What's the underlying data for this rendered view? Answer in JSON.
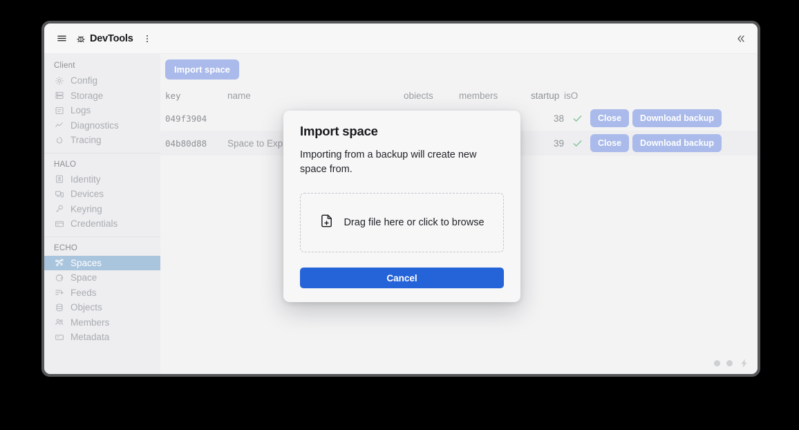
{
  "titlebar": {
    "menu_icon": "hamburger-icon",
    "app_icon": "bug-icon",
    "title": "DevTools",
    "overflow_icon": "more-vertical-icon",
    "collapse_icon": "chevrons-left-icon"
  },
  "sidebar": {
    "sections": [
      {
        "label": "Client",
        "items": [
          {
            "label": "Config",
            "icon": "gear-icon",
            "active": false
          },
          {
            "label": "Storage",
            "icon": "database-icon",
            "active": false
          },
          {
            "label": "Logs",
            "icon": "list-icon",
            "active": false
          },
          {
            "label": "Diagnostics",
            "icon": "chart-line-icon",
            "active": false
          },
          {
            "label": "Tracing",
            "icon": "flame-icon",
            "active": false
          }
        ]
      },
      {
        "label": "HALO",
        "items": [
          {
            "label": "Identity",
            "icon": "id-card-icon",
            "active": false
          },
          {
            "label": "Devices",
            "icon": "devices-icon",
            "active": false
          },
          {
            "label": "Keyring",
            "icon": "key-icon",
            "active": false
          },
          {
            "label": "Credentials",
            "icon": "credit-card-icon",
            "active": false
          }
        ]
      },
      {
        "label": "ECHO",
        "items": [
          {
            "label": "Spaces",
            "icon": "graph-icon",
            "active": true
          },
          {
            "label": "Space",
            "icon": "planet-icon",
            "active": false
          },
          {
            "label": "Feeds",
            "icon": "feed-icon",
            "active": false
          },
          {
            "label": "Objects",
            "icon": "stack-icon",
            "active": false
          },
          {
            "label": "Members",
            "icon": "users-icon",
            "active": false
          },
          {
            "label": "Metadata",
            "icon": "rectangle-icon",
            "active": false
          }
        ]
      }
    ]
  },
  "toolbar": {
    "import_space_label": "Import space"
  },
  "table": {
    "headers": {
      "key": "key",
      "name": "name",
      "objects": "obiects",
      "members": "members",
      "startup": "startup",
      "iso": "isO"
    },
    "rows": [
      {
        "key": "049f3904",
        "name": "",
        "objects": "",
        "members": "",
        "startup": "38",
        "iso": "check-icon",
        "close_label": "Close",
        "download_label": "Download backup"
      },
      {
        "key": "04b80d88",
        "name": "Space to Exp",
        "objects": "",
        "members": "",
        "startup": "39",
        "iso": "check-icon",
        "close_label": "Close",
        "download_label": "Download backup"
      }
    ]
  },
  "status": {
    "dot_1": "status-dot",
    "dot_2": "status-dot",
    "bolt": "lightning-bolt-icon"
  },
  "modal": {
    "title": "Import space",
    "description": "Importing from a backup will create new space from.",
    "dropzone_icon": "file-plus-icon",
    "dropzone_label": "Drag file here or click to browse",
    "cancel_label": "Cancel"
  },
  "colors": {
    "accent_blue": "#2563d8",
    "pill_blue": "#aabaea",
    "active_item": "#a9c4dd",
    "check_green": "#7fc49a"
  }
}
